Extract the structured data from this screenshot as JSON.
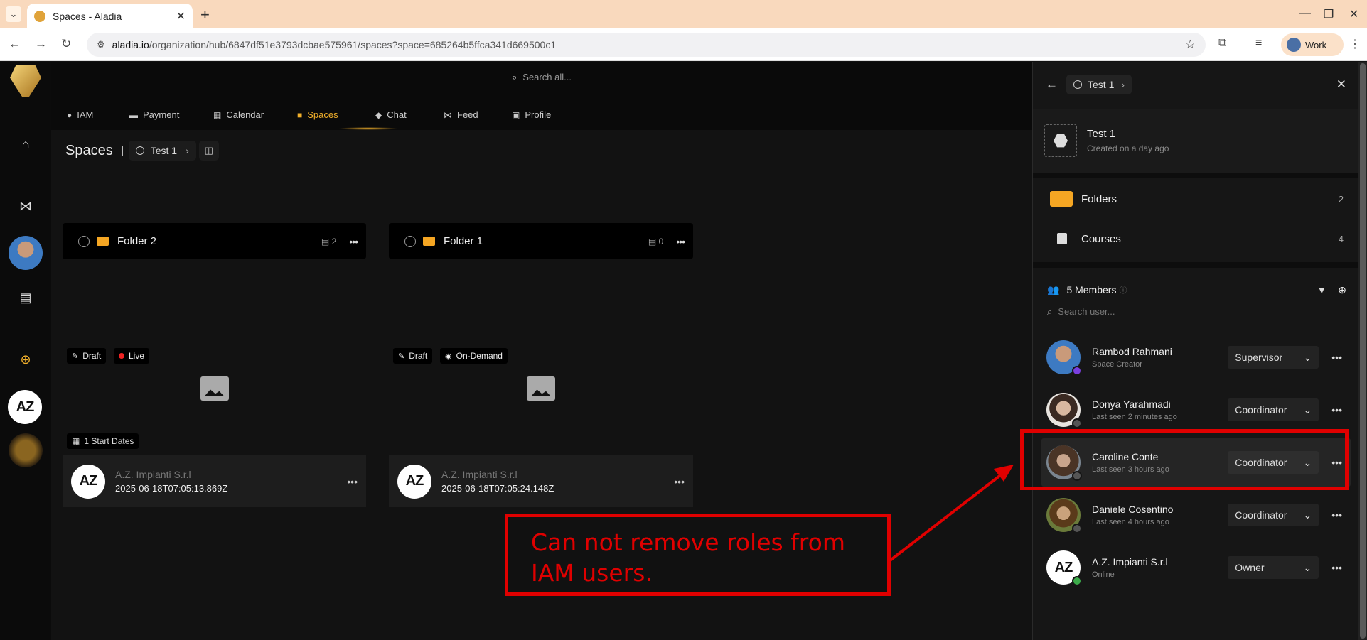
{
  "browser": {
    "tab_title": "Spaces - Aladia",
    "url_domain": "aladia.io",
    "url_path": "/organization/hub/6847df51e3793dcbae575961/spaces?space=685264b5ffca341d669500c1",
    "profile_label": "Work"
  },
  "app": {
    "search_placeholder": "Search all...",
    "nav": [
      "IAM",
      "Payment",
      "Calendar",
      "Spaces",
      "Chat",
      "Feed",
      "Profile"
    ],
    "active_nav": "Spaces",
    "accent_color": "#f2b02b"
  },
  "breadcrumb": {
    "title": "Spaces",
    "space_name": "Test 1"
  },
  "folders": [
    {
      "name": "Folder 2",
      "count": "2"
    },
    {
      "name": "Folder 1",
      "count": "0"
    }
  ],
  "courses": [
    {
      "status": "Draft",
      "mode": "Live",
      "dates": "1 Start Dates",
      "owner": "A.Z. Impianti S.r.l",
      "timestamp": "2025-06-18T07:05:13.869Z"
    },
    {
      "status": "Draft",
      "mode": "On-Demand",
      "owner": "A.Z. Impianti S.r.l",
      "timestamp": "2025-06-18T07:05:24.148Z"
    }
  ],
  "panel": {
    "space_name": "Test 1",
    "space_title": "Test 1",
    "created": "Created on a day ago",
    "folders_label": "Folders",
    "folders_count": "2",
    "courses_label": "Courses",
    "courses_count": "4",
    "members_label": "5 Members",
    "search_placeholder": "Search user...",
    "members": [
      {
        "name": "Rambod Rahmani",
        "status": "Space Creator",
        "role": "Supervisor"
      },
      {
        "name": "Donya Yarahmadi",
        "status": "Last seen 2 minutes ago",
        "role": "Coordinator"
      },
      {
        "name": "Caroline Conte",
        "status": "Last seen 3 hours ago",
        "role": "Coordinator"
      },
      {
        "name": "Daniele Cosentino",
        "status": "Last seen 4 hours ago",
        "role": "Coordinator"
      },
      {
        "name": "A.Z. Impianti S.r.l",
        "status": "Online",
        "role": "Owner"
      }
    ]
  },
  "annotation": {
    "text": "Can not remove roles from IAM users.",
    "color": "#e00000"
  },
  "logo_text": "AZ"
}
